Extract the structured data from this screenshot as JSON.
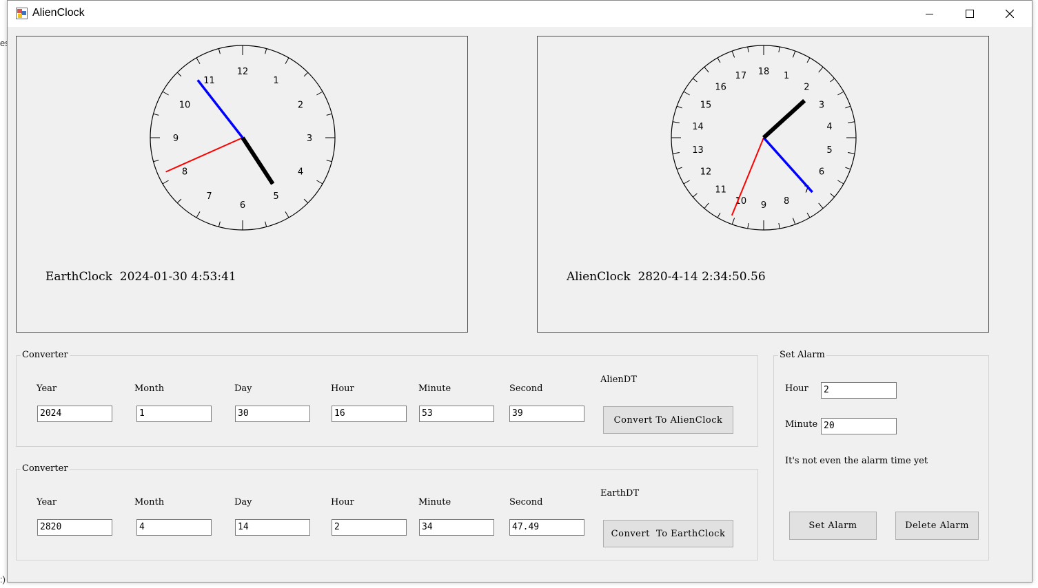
{
  "window": {
    "title": "AlienClock",
    "controls": [
      "minimize-icon",
      "maximize-icon",
      "close-icon"
    ]
  },
  "background_fragments": {
    "left_top": "es",
    "left_bottom": ":)"
  },
  "earth_clock": {
    "numerals": [
      "12",
      "1",
      "2",
      "3",
      "4",
      "5",
      "6",
      "7",
      "8",
      "9",
      "10",
      "11"
    ],
    "caption_label": "EarthClock",
    "caption_datetime": "2024-01-30 4:53:41",
    "time": {
      "hour": 4,
      "minute": 53,
      "second": 41
    },
    "hand_colors": {
      "hour": "#000000",
      "minute": "#0000ff",
      "second": "#ff0000"
    }
  },
  "alien_clock": {
    "numerals": [
      "18",
      "1",
      "2",
      "3",
      "4",
      "5",
      "6",
      "7",
      "8",
      "9",
      "10",
      "11",
      "12",
      "13",
      "14",
      "15",
      "16",
      "17"
    ],
    "caption_label": "AlienClock",
    "caption_datetime": "2820-4-14 2:34:50.56",
    "time": {
      "hour": 2,
      "minute": 34,
      "second": 50.56
    },
    "hand_colors": {
      "hour": "#000000",
      "minute": "#0000ff",
      "second": "#ff0000"
    }
  },
  "converter_earth": {
    "legend": "Converter",
    "labels": {
      "year": "Year",
      "month": "Month",
      "day": "Day",
      "hour": "Hour",
      "minute": "Minute",
      "second": "Second"
    },
    "values": {
      "year": "2024",
      "month": "1",
      "day": "30",
      "hour": "16",
      "minute": "53",
      "second": "39"
    },
    "result_label": "AlienDT",
    "button": "Convert To AlienClock"
  },
  "converter_alien": {
    "legend": "Converter",
    "labels": {
      "year": "Year",
      "month": "Month",
      "day": "Day",
      "hour": "Hour",
      "minute": "Minute",
      "second": "Second"
    },
    "values": {
      "year": "2820",
      "month": "4",
      "day": "14",
      "hour": "2",
      "minute": "34",
      "second": "47.49"
    },
    "result_label": "EarthDT",
    "button": "Convert  To EarthClock"
  },
  "alarm": {
    "legend": "Set Alarm",
    "hour_label": "Hour",
    "hour_value": "2",
    "minute_label": "Minute",
    "minute_value": "20",
    "status": "It's not even the alarm time yet",
    "set_button": "Set Alarm",
    "delete_button": "Delete Alarm"
  }
}
